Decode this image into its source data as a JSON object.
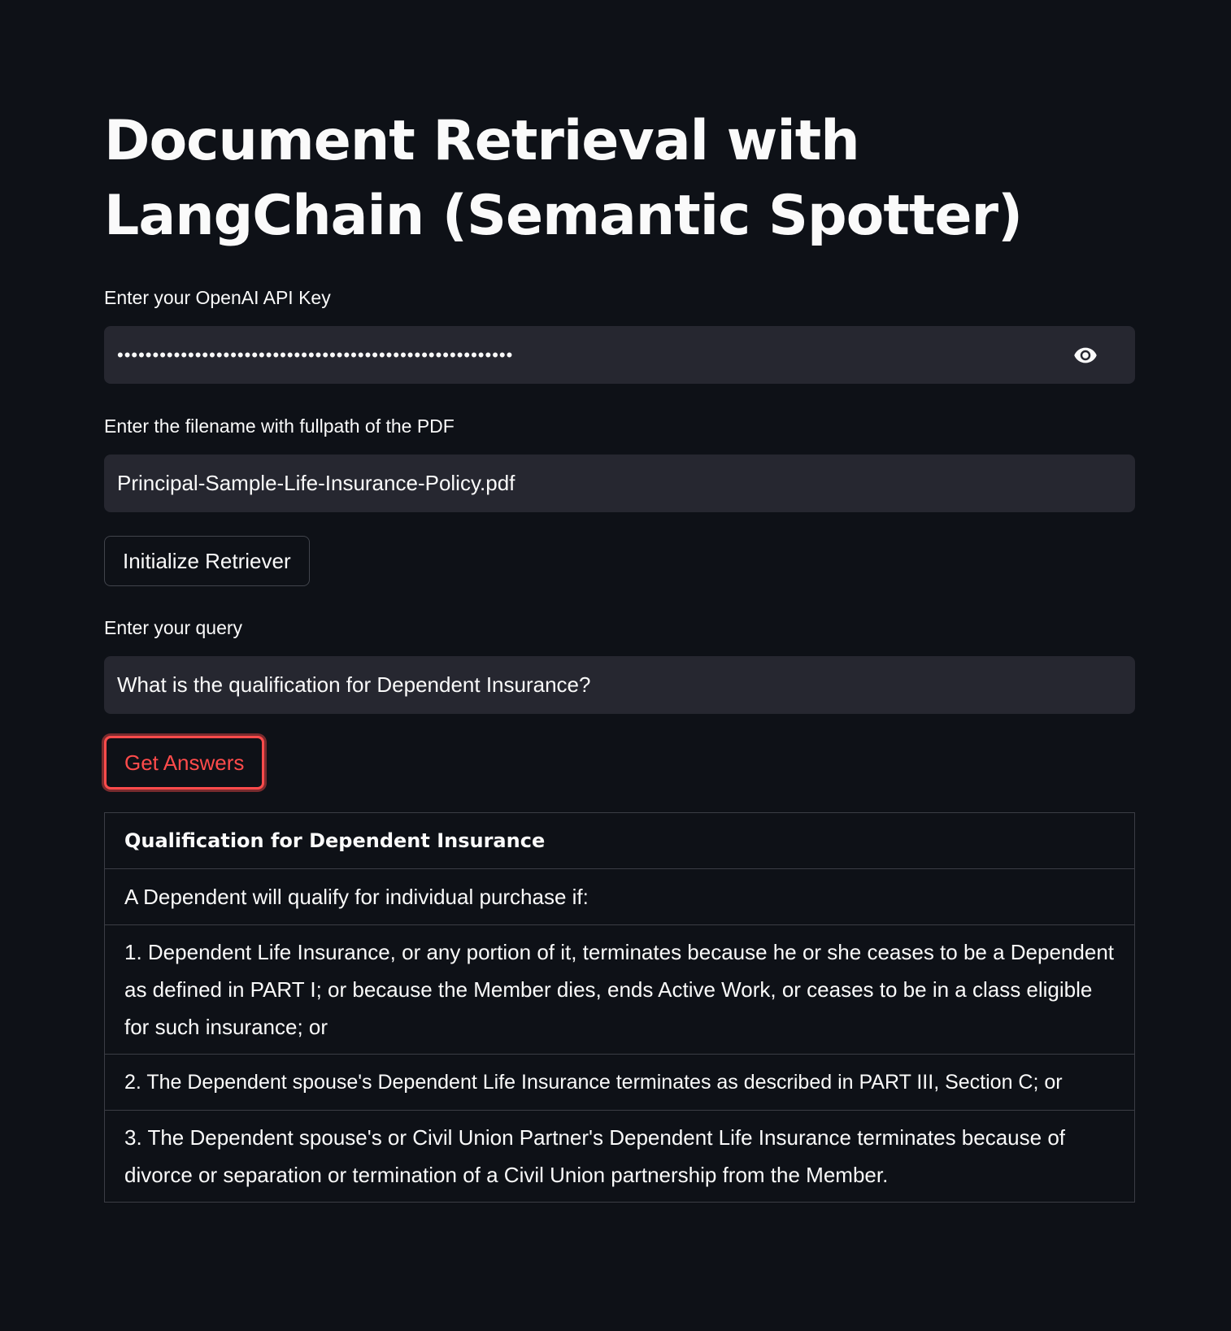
{
  "page": {
    "title": "Document Retrieval with LangChain (Semantic Spotter)"
  },
  "api_key": {
    "label": "Enter your OpenAI API Key",
    "value": "••••••••••••••••••••••••••••••••••••••••••••••••••••••••",
    "toggle_icon": "eye-icon"
  },
  "pdf_path": {
    "label": "Enter the filename with fullpath of the PDF",
    "value": "Principal-Sample-Life-Insurance-Policy.pdf"
  },
  "init_button": {
    "label": "Initialize Retriever"
  },
  "query": {
    "label": "Enter your query",
    "value": "What is the qualification for Dependent Insurance?"
  },
  "answers_button": {
    "label": "Get Answers",
    "accent_color": "#ff4b4b"
  },
  "answer_table": {
    "header": "Qualification for Dependent Insurance",
    "rows": [
      "A Dependent will qualify for individual purchase if:",
      "1. Dependent Life Insurance, or any portion of it, terminates because he or she ceases to be a Dependent as defined in PART I; or because the Member dies, ends Active Work, or ceases to be in a class eligible for such insurance; or",
      "2. The Dependent spouse's Dependent Life Insurance terminates as described in PART III, Section C; or",
      "3. The Dependent spouse's or Civil Union Partner's Dependent Life Insurance terminates because of divorce or separation or termination of a Civil Union partnership from the Member."
    ]
  },
  "colors": {
    "background": "#0e1117",
    "input_background": "#262730",
    "text": "#fafafa",
    "accent": "#ff4b4b"
  }
}
